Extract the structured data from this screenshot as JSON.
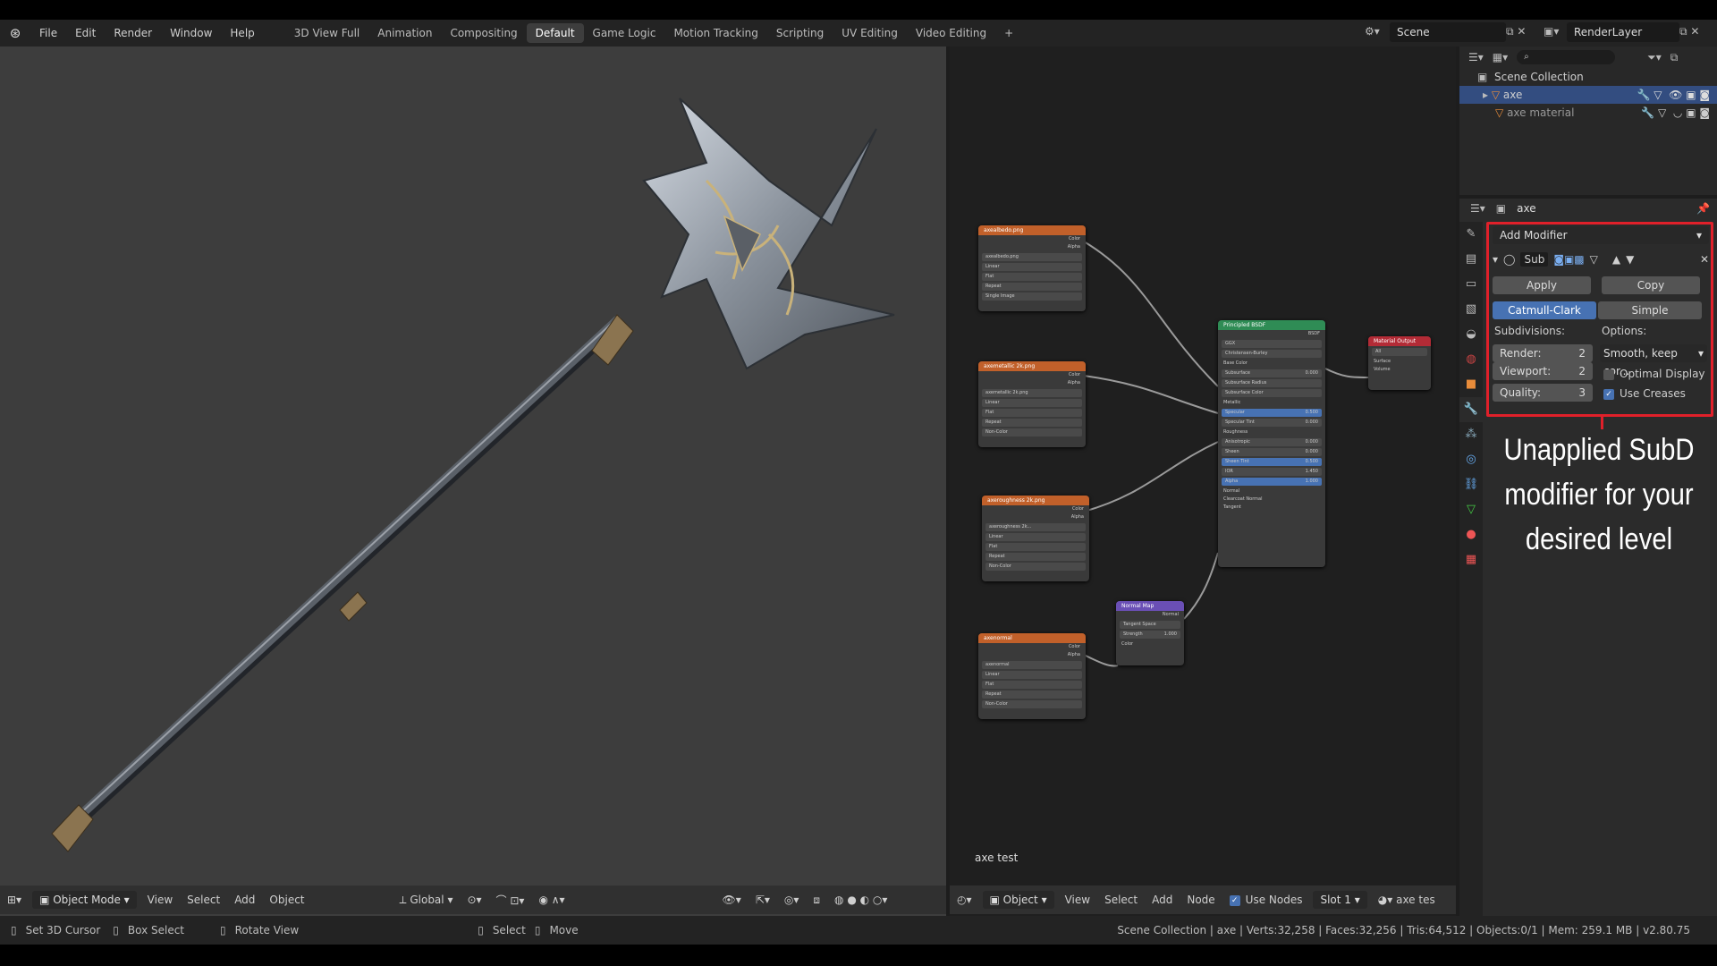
{
  "menu": {
    "items": [
      "File",
      "Edit",
      "Render",
      "Window",
      "Help"
    ]
  },
  "workspace_tabs": [
    {
      "label": "3D View Full"
    },
    {
      "label": "Animation"
    },
    {
      "label": "Compositing"
    },
    {
      "label": "Default"
    },
    {
      "label": "Game Logic"
    },
    {
      "label": "Motion Tracking"
    },
    {
      "label": "Scripting"
    },
    {
      "label": "UV Editing"
    },
    {
      "label": "Video Editing"
    }
  ],
  "scene": {
    "name": "Scene",
    "render_layer": "RenderLayer"
  },
  "viewport": {
    "mode": "Object Mode",
    "menus": [
      "View",
      "Select",
      "Add",
      "Object"
    ],
    "orientation": "Global"
  },
  "node_editor": {
    "label": "axe test",
    "type": "Object",
    "menus": [
      "View",
      "Select",
      "Add",
      "Node"
    ],
    "use_nodes": "Use Nodes",
    "slot": "Slot 1",
    "material": "axe tes",
    "nodes": {
      "tex1": {
        "title": "axealbedo.png",
        "img": "axealbedo.png",
        "out1": "Color",
        "out2": "Alpha",
        "rows": [
          "Linear",
          "Flat",
          "Repeat",
          "Single Image"
        ],
        "cs_label": "Color Space",
        "cs_value": "sRGB",
        "vec": "Vector"
      },
      "tex2": {
        "title": "axemetallic 2k.png",
        "img": "axemetallic 2k.png",
        "out1": "Color",
        "out2": "Alpha",
        "rows": [
          "Linear",
          "Flat",
          "Repeat",
          "Single Image"
        ],
        "cs_label": "Color Space",
        "cs_value": "Non-Color",
        "vec": "Vector"
      },
      "tex3": {
        "title": "axeroughness 2k.png",
        "img": "axeroughness 2k...",
        "out1": "Color",
        "out2": "Alpha",
        "rows": [
          "Linear",
          "Flat",
          "Repeat",
          "Single Image"
        ],
        "cs_label": "Color Space",
        "cs_value": "Non-Color",
        "vec": "Vector"
      },
      "tex4": {
        "title": "axenormal",
        "img": "axenormal",
        "out1": "Color",
        "out2": "Alpha",
        "rows": [
          "Linear",
          "Flat",
          "Repeat",
          "Single Image"
        ],
        "cs_label": "Color Space",
        "cs_value": "Non-Color",
        "vec": "Vector"
      },
      "bsdf": {
        "title": "Principled BSDF",
        "out": "BSDF",
        "rows": [
          "GGX",
          "Christensen-Burley",
          "Base Color",
          "Subsurface",
          "Subsurface Radius",
          "Subsurface Color",
          "Metallic",
          "Specular",
          "Specular Tint",
          "Roughness",
          "Anisotropic",
          "Anisotropic Rotation",
          "Sheen",
          "Sheen Tint",
          "Clearcoat",
          "Clearcoat Roughness",
          "IOR",
          "Transmission",
          "Transmission Roughness",
          "Emission",
          "Alpha",
          "Normal",
          "Clearcoat Normal",
          "Tangent"
        ],
        "vals": {
          "Subsurface": "0.000",
          "Specular": "0.500",
          "Specular Tint": "0.000",
          "Anisotropic": "0.000",
          "Anisotropic Rotation": "0.000",
          "Sheen": "0.000",
          "Sheen Tint": "0.500",
          "Clearcoat": "0.000",
          "Clearcoat Roughness": "0.030",
          "IOR": "1.450",
          "Transmission": "0.000",
          "Transmission Roughness": "0.000",
          "Alpha": "1.000"
        }
      },
      "output": {
        "title": "Material Output",
        "target": "All",
        "rows": [
          "Surface",
          "Volume",
          "Displacement"
        ]
      },
      "normalmap": {
        "title": "Normal Map",
        "out": "Normal",
        "space": "Tangent Space",
        "strength_label": "Strength",
        "strength": "1.000",
        "in": "Color"
      }
    }
  },
  "outliner": {
    "root": "Scene Collection",
    "items": [
      {
        "name": "axe"
      },
      {
        "name": "axe material"
      }
    ]
  },
  "properties": {
    "object": "axe",
    "add_modifier": "Add Modifier",
    "mod_name": "Sub",
    "apply": "Apply",
    "copy": "Copy",
    "catmull": "Catmull-Clark",
    "simple": "Simple",
    "subdivisions": "Subdivisions:",
    "options": "Options:",
    "render_label": "Render:",
    "render_val": "2",
    "viewport_label": "Viewport:",
    "viewport_val": "2",
    "quality_label": "Quality:",
    "quality_val": "3",
    "uv_smooth": "Smooth, keep cor...",
    "optimal": "Optimal Display",
    "creases": "Use Creases",
    "highlight_color": "#e0202a"
  },
  "annotation": {
    "line1": "Unapplied SubD",
    "line2": "modifier for your",
    "line3": "desired level"
  },
  "status": {
    "left": [
      "Set 3D Cursor",
      "Box Select",
      "Rotate View",
      "Select",
      "Move"
    ],
    "stats": "Scene Collection | axe | Verts:32,258 | Faces:32,256 | Tris:64,512 | Objects:0/1 | Mem: 259.1 MB | v2.80.75"
  }
}
